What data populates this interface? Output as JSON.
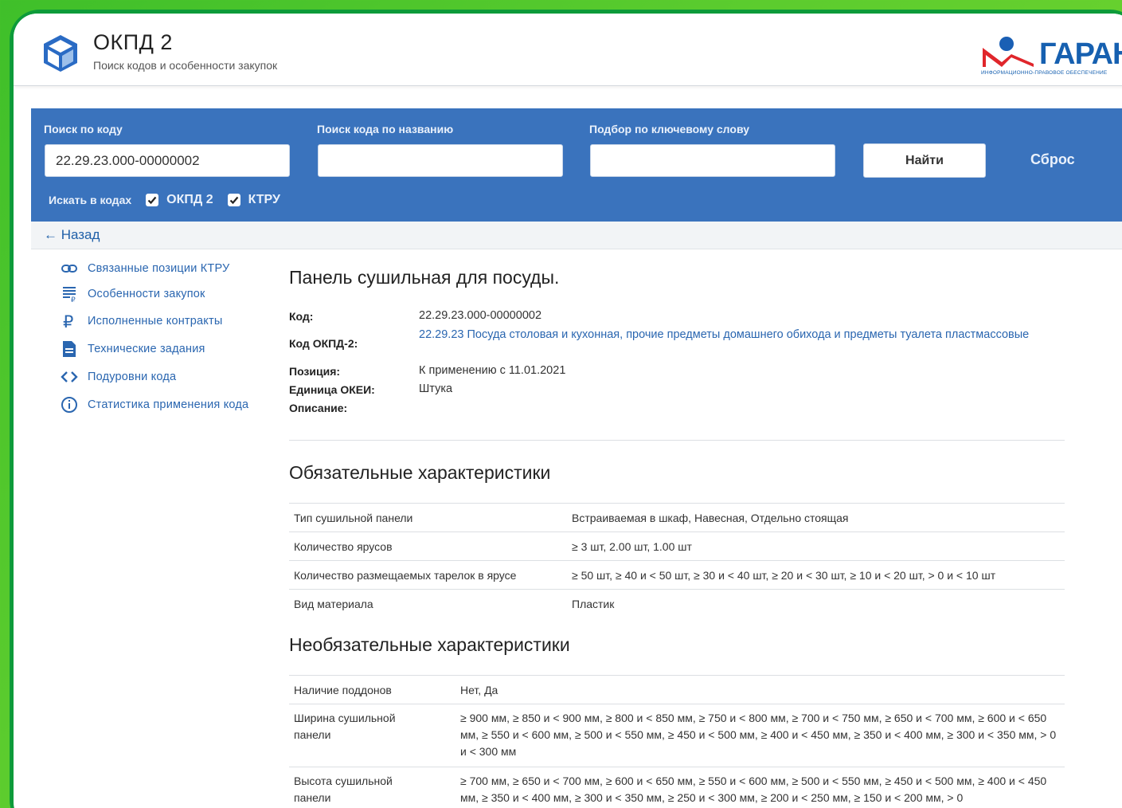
{
  "header": {
    "title": "ОКПД 2",
    "subtitle": "Поиск кодов и особенности закупок",
    "garant_logo_text": "ГАРАНТ",
    "garant_logo_subtext": "ИНФОРМАЦИОННО-ПРАВОВОЕ ОБЕСПЕЧЕНИЕ"
  },
  "search": {
    "by_code_label": "Поиск по коду",
    "by_code_value": "22.29.23.000-00000002",
    "by_name_label": "Поиск кода по названию",
    "by_name_value": "",
    "by_keyword_label": "Подбор по ключевому слову",
    "by_keyword_value": "",
    "find_button": "Найти",
    "reset_link": "Сброс",
    "search_in_label": "Искать в кодах",
    "checkbox_okpd": "ОКПД 2",
    "checkbox_ktru": "КТРУ"
  },
  "back_link": "← Назад",
  "sidebar": {
    "items": [
      {
        "label": "Связанные позиции КТРУ",
        "icon": "link-icon"
      },
      {
        "label": "Особенности закупок",
        "icon": "list-rouble-icon"
      },
      {
        "label": "Исполненные контракты",
        "icon": "rouble-icon"
      },
      {
        "label": "Технические задания",
        "icon": "document-icon"
      },
      {
        "label": "Подуровни кода",
        "icon": "code-brackets-icon"
      },
      {
        "label": "Статистика применения кода",
        "icon": "info-icon"
      }
    ]
  },
  "product": {
    "title": "Панель сушильная для посуды.",
    "code_label": "Код:",
    "code_value": "22.29.23.000-00000002",
    "okpd_label": "Код ОКПД-2:",
    "okpd_value": "22.29.23 Посуда столовая и кухонная, прочие предметы домашнего обихода и предметы туалета пластмассовые",
    "position_label": "Позиция:",
    "position_value": "К применению с 11.01.2021",
    "unit_label": "Единица ОКЕИ:",
    "unit_value": "Штука",
    "description_label": "Описание:"
  },
  "mandatory": {
    "title": "Обязательные характеристики",
    "rows": [
      {
        "name": "Тип сушильной панели",
        "value": "Встраиваемая в шкаф, Навесная, Отдельно стоящая"
      },
      {
        "name": "Количество ярусов",
        "value": "≥ 3 шт, 2.00 шт, 1.00 шт"
      },
      {
        "name": "Количество размещаемых тарелок в ярусе",
        "value": "≥ 50 шт, ≥ 40 и < 50 шт, ≥ 30 и < 40 шт, ≥ 20 и < 30 шт, ≥ 10 и < 20 шт, > 0 и < 10 шт"
      },
      {
        "name": "Вид материала",
        "value": "Пластик"
      }
    ]
  },
  "optional": {
    "title": "Необязательные характеристики",
    "rows": [
      {
        "name": "Наличие поддонов",
        "value": "Нет, Да"
      },
      {
        "name": "Ширина сушильной панели",
        "value": "≥ 900 мм, ≥ 850 и < 900 мм, ≥ 800 и < 850 мм, ≥ 750 и < 800 мм, ≥ 700 и < 750 мм, ≥ 650 и < 700 мм, ≥ 600 и < 650 мм, ≥ 550 и < 600 мм, ≥ 500 и < 550 мм, ≥ 450 и < 500 мм, ≥ 400 и < 450 мм, ≥ 350 и < 400 мм, ≥ 300 и < 350 мм, > 0 и < 300 мм"
      },
      {
        "name": "Высота сушильной панели",
        "value": "≥ 700 мм, ≥ 650 и < 700 мм, ≥ 600 и < 650 мм, ≥ 550 и < 600 мм, ≥ 500 и < 550 мм, ≥ 450 и < 500 мм, ≥ 400 и < 450 мм, ≥ 350 и < 400 мм, ≥ 300 и < 350 мм, ≥ 250 и < 300 мм, ≥ 200 и < 250 мм, ≥ 150 и < 200 мм, > 0"
      }
    ]
  },
  "colors": {
    "accent_blue": "#3a73bd",
    "link_blue": "#2a66b0",
    "frame_green": "#0d9b3a"
  }
}
